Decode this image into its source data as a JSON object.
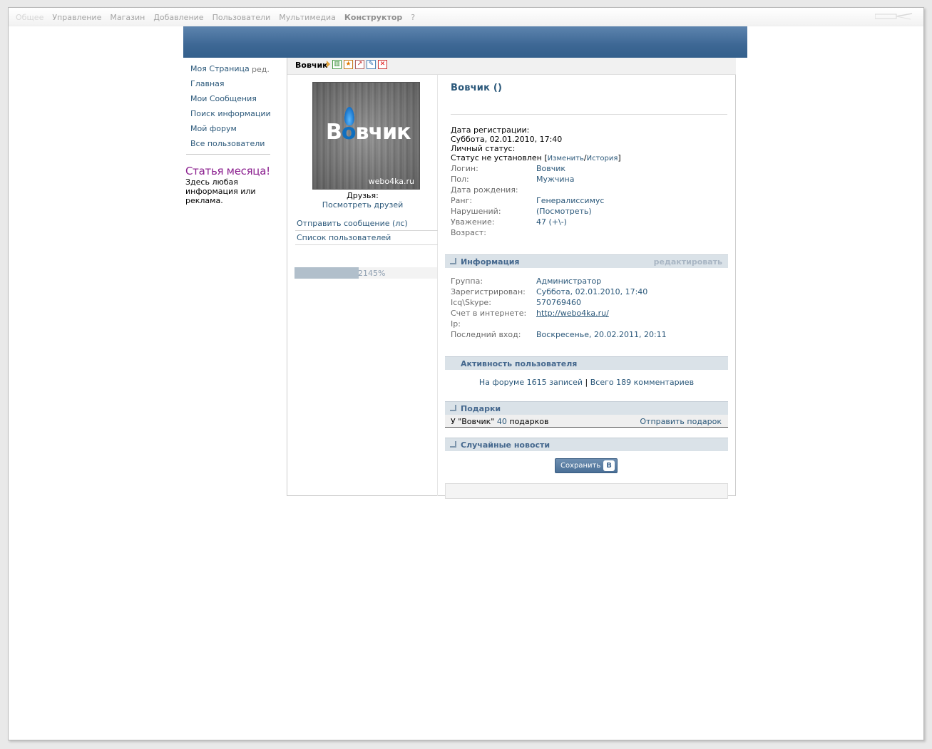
{
  "topmenu": {
    "items": [
      "Общее",
      "Управление",
      "Магазин",
      "Добавление",
      "Пользователи",
      "Мультимедиа",
      "Конструктор",
      "?"
    ]
  },
  "sidebar": {
    "items": [
      {
        "label": "Моя Страница"
      },
      {
        "label": "Главная"
      },
      {
        "label": "Мои Сообщения"
      },
      {
        "label": "Поиск информации"
      },
      {
        "label": "Мой форум"
      },
      {
        "label": "Все пользователи"
      }
    ],
    "edit_label": "ред.",
    "article_title": "Статья месяца!",
    "article_text": "Здесь любая информация или реклама."
  },
  "profile": {
    "title_username": "Вовчик",
    "avatar": {
      "logo_text_1": "В",
      "logo_text_2": "о",
      "logo_text_3": "вчик",
      "site": "webo4ka.ru"
    },
    "friends_label": "Друзья:",
    "friends_link": "Посмотреть друзей",
    "actions": [
      "Отправить сообщение (лс)",
      "Список пользователей"
    ],
    "progress": {
      "label": "2145%",
      "fill_fraction": 0.45
    },
    "name_heading": "Вовчик ()",
    "reg_label": "Дата регистрации:",
    "reg_date": "Суббота, 02.01.2010, 17:40",
    "status_label": "Личный статус:",
    "status_text": "Статус не установлен [",
    "status_change": "Изменить",
    "status_sep": "/",
    "status_history": "История",
    "status_close": "]",
    "fields": [
      {
        "label": "Логин:",
        "value": "Вовчик"
      },
      {
        "label": "Пол:",
        "value": "Мужчина"
      },
      {
        "label": "Дата рождения:",
        "value": ""
      },
      {
        "label": "Ранг:",
        "value": "Генералиссимус"
      },
      {
        "label": "Нарушений:",
        "value": "(Посмотреть)"
      },
      {
        "label": "Уважение:",
        "value": "47 (+\\-)"
      },
      {
        "label": "Возраст:",
        "value": ""
      }
    ]
  },
  "info_section": {
    "title": "Информация",
    "edit": "редактировать",
    "fields": [
      {
        "label": "Группа:",
        "value": "Администратор"
      },
      {
        "label": "Зарегистрирован:",
        "value": "Суббота, 02.01.2010, 17:40"
      },
      {
        "label": "Icq\\Skype:",
        "value": "570769460"
      },
      {
        "label": "Счет в интернете:",
        "value": "http://webo4ka.ru/"
      },
      {
        "label": "Ip:",
        "value": ""
      },
      {
        "label": "Последний вход:",
        "value": "Воскресенье, 20.02.2011, 20:11"
      }
    ]
  },
  "activity_section": {
    "title": "Активность пользователя",
    "forum_text": "На форуме 1615 записей",
    "sep": "|",
    "comments_text": "Всего 189 комментариев"
  },
  "gifts_section": {
    "title": "Подарки",
    "prefix": "У \"Вовчик\"",
    "count": "40",
    "suffix": "подарков",
    "send": "Отправить подарок"
  },
  "news_section": {
    "title": "Случайные новости"
  },
  "save_button": {
    "label": "Сохранить",
    "badge": "B"
  },
  "colors": {
    "accent": "#2b587a",
    "header": "#3d6794",
    "section": "#dae2e8",
    "article_title": "#8b1f8f"
  }
}
